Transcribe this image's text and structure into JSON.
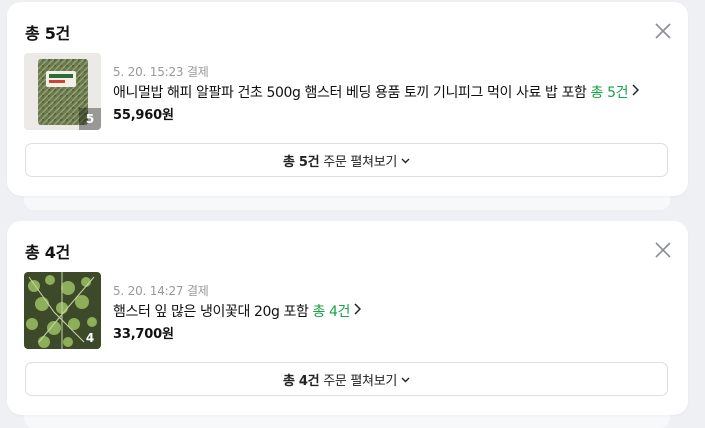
{
  "orders": [
    {
      "title": "총 5건",
      "date": "5. 20. 15:23 결제",
      "product_name": "애니멀밥 해피 알팔파 건초 500g 햄스터 베딩 용품 토끼 기니피그 먹이 사료 밥 포함",
      "included_label": "총 5건",
      "price": "55,960원",
      "thumb_count": "5",
      "expand_total": "총 5건",
      "expand_label": "주문 펼쳐보기"
    },
    {
      "title": "총 4건",
      "date": "5. 20. 14:27 결제",
      "product_name": "햄스터 잎 많은 냉이꽃대 20g 포함",
      "included_label": "총 4건",
      "price": "33,700원",
      "thumb_count": "4",
      "expand_total": "총 4건",
      "expand_label": "주문 펼쳐보기"
    }
  ],
  "colors": {
    "accent_green": "#19a34a",
    "background": "#eef0f3"
  },
  "icons": {
    "close": "close-icon",
    "chevron_right": "chevron-right-icon",
    "chevron_down": "chevron-down-icon"
  }
}
